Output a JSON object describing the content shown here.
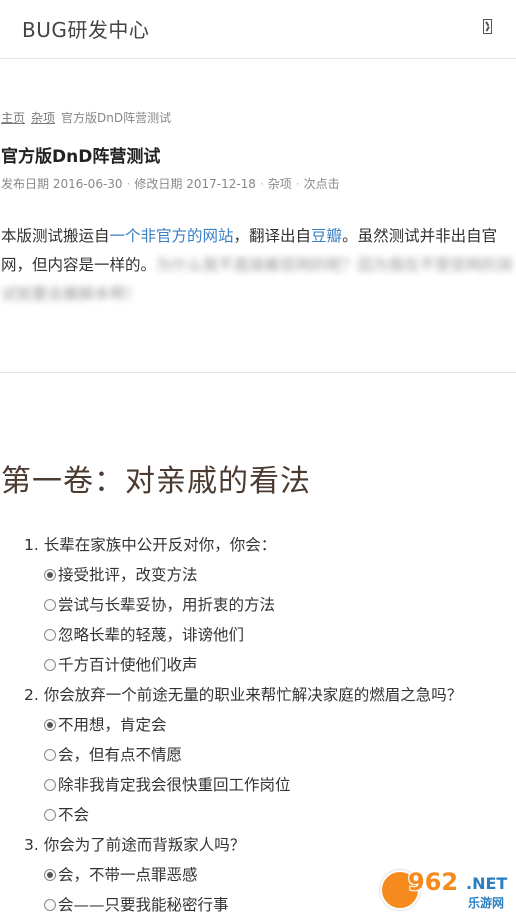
{
  "header": {
    "site_title": "BUG研发中心",
    "menu_icon": "menu-icon"
  },
  "breadcrumb": {
    "home": "主页",
    "category": "杂项",
    "current": "官方版DnD阵营测试"
  },
  "post": {
    "title": "官方版DnD阵营测试",
    "meta": {
      "published": "发布日期 2016-06-30",
      "modified": "修改日期 2017-12-18",
      "category": "杂项",
      "views": "次点击"
    },
    "intro": {
      "part1": "本版测试搬运自",
      "link1": "一个非官方的网站",
      "part2": "，翻译出自",
      "link2": "豆瓣",
      "part3": "。虽然测试并非出自官网，但内容是一样的。",
      "blurred": "为什么我不直接搬官网的呢？因为我在不登官网的测试就要去搬脚本啊！"
    }
  },
  "section": {
    "heading": "第一卷：对亲戚的看法"
  },
  "questions": [
    {
      "text": "1. 长辈在家族中公开反对你，你会：",
      "options": [
        {
          "label": "接受批评，改变方法",
          "checked": true
        },
        {
          "label": "尝试与长辈妥协，用折衷的方法",
          "checked": false
        },
        {
          "label": "忽略长辈的轻蔑，诽谤他们",
          "checked": false
        },
        {
          "label": "千方百计使他们收声",
          "checked": false
        }
      ]
    },
    {
      "text": "2. 你会放弃一个前途无量的职业来帮忙解决家庭的燃眉之急吗？",
      "options": [
        {
          "label": "不用想，肯定会",
          "checked": true
        },
        {
          "label": "会，但有点不情愿",
          "checked": false
        },
        {
          "label": "除非我肯定我会很快重回工作岗位",
          "checked": false
        },
        {
          "label": "不会",
          "checked": false
        }
      ]
    },
    {
      "text": "3. 你会为了前途而背叛家人吗？",
      "options": [
        {
          "label": "会，不带一点罪恶感",
          "checked": true
        },
        {
          "label": "会——只要我能秘密行事",
          "checked": false
        }
      ]
    }
  ],
  "watermark": {
    "number": "962",
    "net": ".NET",
    "sub": "乐游网"
  },
  "colors": {
    "link": "#3b7fc4",
    "heading": "#4a3a30",
    "watermark_orange": "#f58a1f",
    "watermark_blue": "#2a7fc0"
  }
}
